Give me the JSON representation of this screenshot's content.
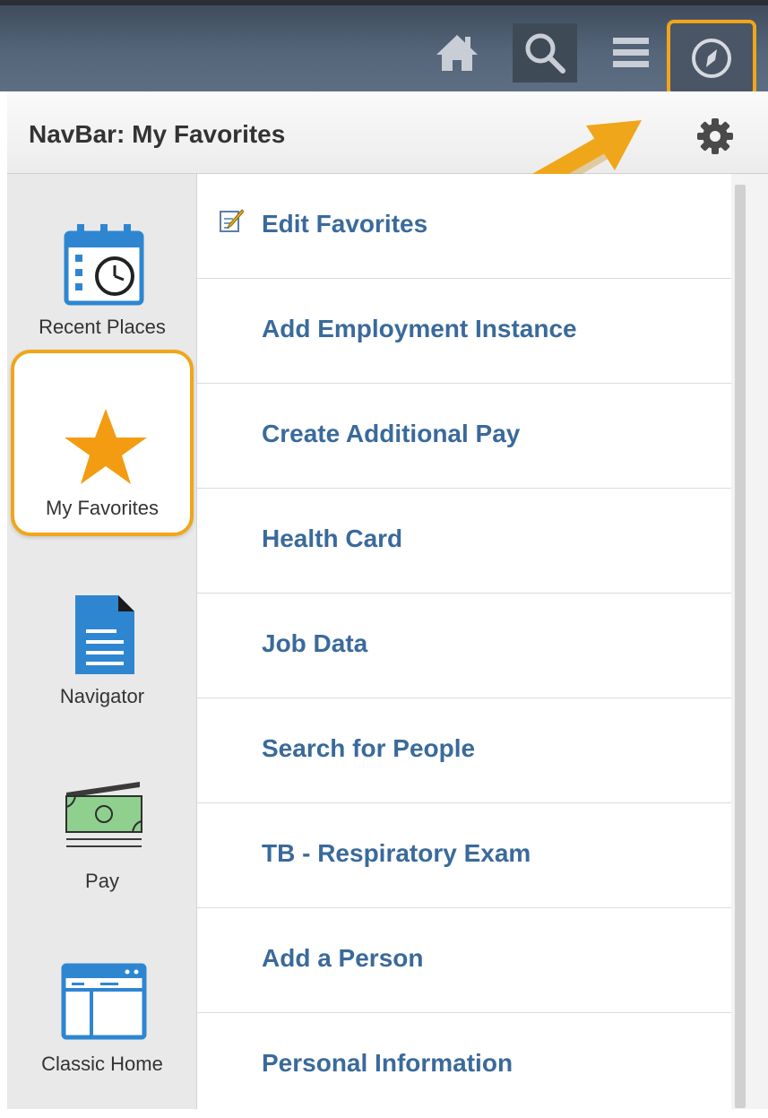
{
  "topbar": {
    "icons": [
      "home-icon",
      "search-icon",
      "menu-icon",
      "navbar-compass-icon"
    ],
    "highlight_color": "#f0a61a"
  },
  "header": {
    "title": "NavBar: My Favorites",
    "settings_icon": "gear-icon"
  },
  "sidebar": {
    "items": [
      {
        "label": "Recent Places",
        "icon": "calendar-clock-icon"
      },
      {
        "label": "My Favorites",
        "icon": "star-icon",
        "selected": true
      },
      {
        "label": "Navigator",
        "icon": "document-icon"
      },
      {
        "label": "Pay",
        "icon": "money-icon"
      },
      {
        "label": "Classic Home",
        "icon": "browser-window-icon"
      }
    ]
  },
  "favorites": {
    "items": [
      {
        "label": "Edit Favorites",
        "icon": "edit-icon"
      },
      {
        "label": "Add Employment Instance"
      },
      {
        "label": "Create Additional Pay"
      },
      {
        "label": "Health Card"
      },
      {
        "label": "Job Data"
      },
      {
        "label": "Search for People"
      },
      {
        "label": "TB - Respiratory Exam"
      },
      {
        "label": "Add a Person"
      },
      {
        "label": "Personal Information"
      }
    ]
  },
  "colors": {
    "accent": "#f0a61a",
    "link": "#3a6a9b",
    "topbar": "#4f5e71",
    "icon_blue": "#2e86d1"
  }
}
